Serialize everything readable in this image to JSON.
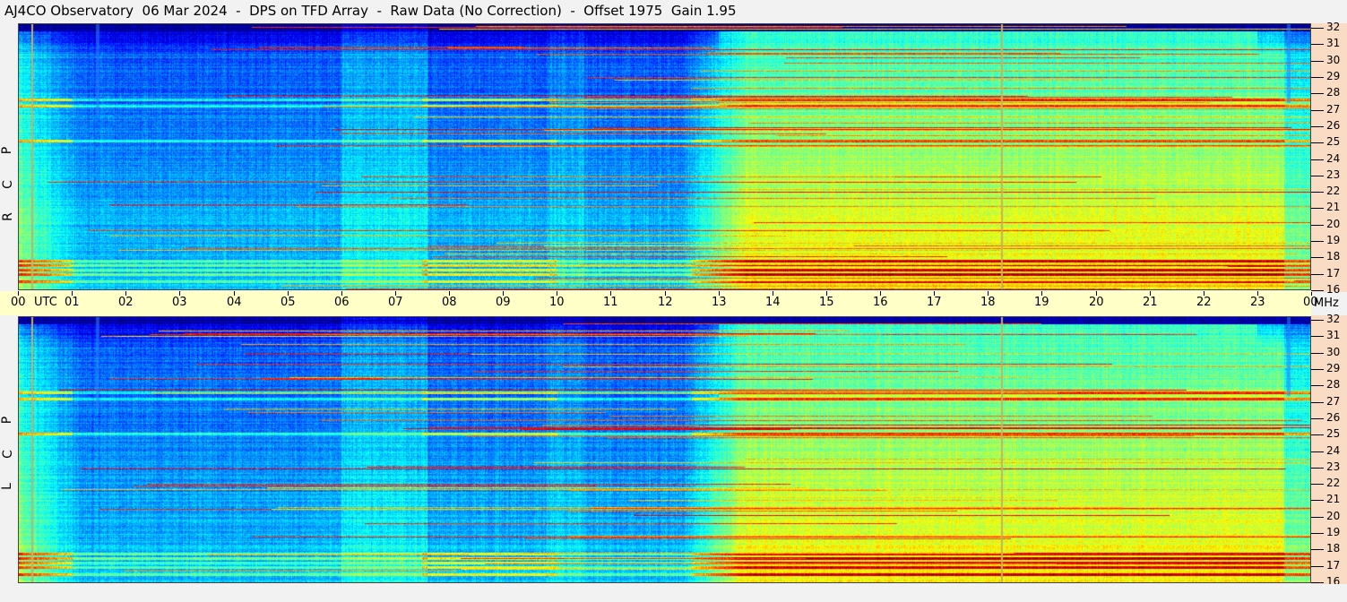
{
  "title": "AJ4CO Observatory  06 Mar 2024  -  DPS on TFD Array  -  Raw Data (No Correction)  -  Offset 1975  Gain 1.95",
  "panels": {
    "top": {
      "label_letters": [
        "P",
        "C",
        "R"
      ]
    },
    "bottom": {
      "label_letters": [
        "P",
        "C",
        "L"
      ]
    }
  },
  "time_axis": {
    "utc_label": "UTC",
    "ticks": [
      "00",
      "01",
      "02",
      "03",
      "04",
      "05",
      "06",
      "07",
      "08",
      "09",
      "10",
      "11",
      "12",
      "13",
      "14",
      "15",
      "16",
      "17",
      "18",
      "19",
      "20",
      "21",
      "22",
      "23",
      "00"
    ]
  },
  "freq_axis": {
    "unit": "MHz",
    "ticks": [
      "32",
      "31",
      "30",
      "29",
      "28",
      "27",
      "26",
      "25",
      "24",
      "23",
      "22",
      "21",
      "20",
      "19",
      "18",
      "17",
      "16"
    ]
  },
  "colors": {
    "axis_bg": "#ffffc8",
    "freq_bg": "#fadbc4",
    "marker_line": "#c8b060"
  },
  "chart_data": {
    "type": "heatmap",
    "title": "AJ4CO Observatory  06 Mar 2024  -  DPS on TFD Array  -  Raw Data (No Correction)  -  Offset 1975  Gain 1.95",
    "xlabel": "UTC",
    "ylabel": "MHz",
    "x_range_utc_hours": [
      0,
      24
    ],
    "y_range_mhz": [
      16,
      32
    ],
    "panels": [
      "RCP",
      "LCP"
    ],
    "vertical_markers_utc_hours": [
      0.25,
      18.25
    ],
    "colormap": "jet (dark blue = low, red = high)"
  }
}
